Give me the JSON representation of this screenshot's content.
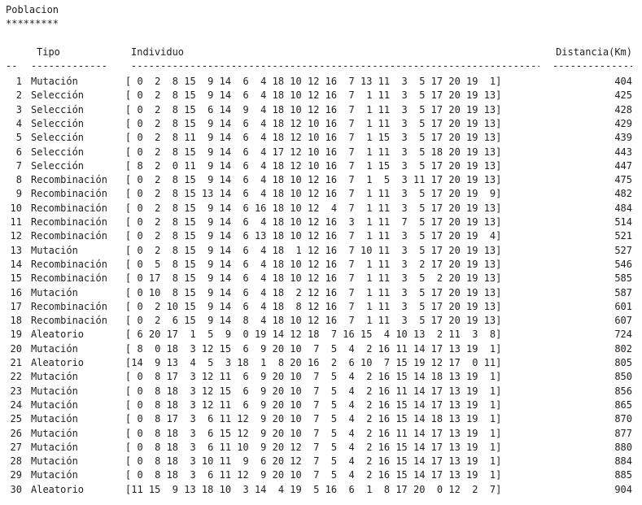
{
  "title": "Poblacion",
  "title_underline": "*********",
  "headers": {
    "tipo": "Tipo",
    "individuo": "Individuo",
    "distancia": "Distancia(Km)"
  },
  "separator": {
    "idx": "--",
    "tipo": "-------------",
    "individuo": "------------------------------------------------------------------------------------",
    "distancia": "--------------"
  },
  "rows": [
    {
      "idx": "1",
      "tipo": "Mutación",
      "individuo": "[ 0  2  8 15  9 14  6  4 18 10 12 16  7 13 11  3  5 17 20 19  1]",
      "distancia": "404"
    },
    {
      "idx": "2",
      "tipo": "Selección",
      "individuo": "[ 0  2  8 15  9 14  6  4 18 10 12 16  7  1 11  3  5 17 20 19 13]",
      "distancia": "425"
    },
    {
      "idx": "3",
      "tipo": "Selección",
      "individuo": "[ 0  2  8 15  6 14  9  4 18 10 12 16  7  1 11  3  5 17 20 19 13]",
      "distancia": "428"
    },
    {
      "idx": "4",
      "tipo": "Selección",
      "individuo": "[ 0  2  8 15  9 14  6  4 18 12 10 16  7  1 11  3  5 17 20 19 13]",
      "distancia": "429"
    },
    {
      "idx": "5",
      "tipo": "Selección",
      "individuo": "[ 0  2  8 11  9 14  6  4 18 12 10 16  7  1 15  3  5 17 20 19 13]",
      "distancia": "439"
    },
    {
      "idx": "6",
      "tipo": "Selección",
      "individuo": "[ 0  2  8 15  9 14  6  4 17 12 10 16  7  1 11  3  5 18 20 19 13]",
      "distancia": "443"
    },
    {
      "idx": "7",
      "tipo": "Selección",
      "individuo": "[ 8  2  0 11  9 14  6  4 18 12 10 16  7  1 15  3  5 17 20 19 13]",
      "distancia": "447"
    },
    {
      "idx": "8",
      "tipo": "Recombinación",
      "individuo": "[ 0  2  8 15  9 14  6  4 18 10 12 16  7  1  5  3 11 17 20 19 13]",
      "distancia": "475"
    },
    {
      "idx": "9",
      "tipo": "Recombinación",
      "individuo": "[ 0  2  8 15 13 14  6  4 18 10 12 16  7  1 11  3  5 17 20 19  9]",
      "distancia": "482"
    },
    {
      "idx": "10",
      "tipo": "Recombinación",
      "individuo": "[ 0  2  8 15  9 14  6 16 18 10 12  4  7  1 11  3  5 17 20 19 13]",
      "distancia": "484"
    },
    {
      "idx": "11",
      "tipo": "Recombinación",
      "individuo": "[ 0  2  8 15  9 14  6  4 18 10 12 16  3  1 11  7  5 17 20 19 13]",
      "distancia": "514"
    },
    {
      "idx": "12",
      "tipo": "Recombinación",
      "individuo": "[ 0  2  8 15  9 14  6 13 18 10 12 16  7  1 11  3  5 17 20 19  4]",
      "distancia": "521"
    },
    {
      "idx": "13",
      "tipo": "Mutación",
      "individuo": "[ 0  2  8 15  9 14  6  4 18  1 12 16  7 10 11  3  5 17 20 19 13]",
      "distancia": "527"
    },
    {
      "idx": "14",
      "tipo": "Recombinación",
      "individuo": "[ 0  5  8 15  9 14  6  4 18 10 12 16  7  1 11  3  2 17 20 19 13]",
      "distancia": "546"
    },
    {
      "idx": "15",
      "tipo": "Recombinación",
      "individuo": "[ 0 17  8 15  9 14  6  4 18 10 12 16  7  1 11  3  5  2 20 19 13]",
      "distancia": "585"
    },
    {
      "idx": "16",
      "tipo": "Mutación",
      "individuo": "[ 0 10  8 15  9 14  6  4 18  2 12 16  7  1 11  3  5 17 20 19 13]",
      "distancia": "587"
    },
    {
      "idx": "17",
      "tipo": "Recombinación",
      "individuo": "[ 0  2 10 15  9 14  6  4 18  8 12 16  7  1 11  3  5 17 20 19 13]",
      "distancia": "601"
    },
    {
      "idx": "18",
      "tipo": "Recombinación",
      "individuo": "[ 0  2  6 15  9 14  8  4 18 10 12 16  7  1 11  3  5 17 20 19 13]",
      "distancia": "607"
    },
    {
      "idx": "19",
      "tipo": "Aleatorio",
      "individuo": "[ 6 20 17  1  5  9  0 19 14 12 18  7 16 15  4 10 13  2 11  3  8]",
      "distancia": "724"
    },
    {
      "idx": "20",
      "tipo": "Mutación",
      "individuo": "[ 8  0 18  3 12 15  6  9 20 10  7  5  4  2 16 11 14 17 13 19  1]",
      "distancia": "802"
    },
    {
      "idx": "21",
      "tipo": "Aleatorio",
      "individuo": "[14  9 13  4  5  3 18  1  8 20 16  2  6 10  7 15 19 12 17  0 11]",
      "distancia": "805"
    },
    {
      "idx": "22",
      "tipo": "Mutación",
      "individuo": "[ 0  8 17  3 12 11  6  9 20 10  7  5  4  2 16 15 14 18 13 19  1]",
      "distancia": "850"
    },
    {
      "idx": "23",
      "tipo": "Mutación",
      "individuo": "[ 0  8 18  3 12 15  6  9 20 10  7  5  4  2 16 11 14 17 13 19  1]",
      "distancia": "856"
    },
    {
      "idx": "24",
      "tipo": "Mutación",
      "individuo": "[ 0  8 18  3 12 11  6  9 20 10  7  5  4  2 16 15 14 17 13 19  1]",
      "distancia": "865"
    },
    {
      "idx": "25",
      "tipo": "Mutación",
      "individuo": "[ 0  8 17  3  6 11 12  9 20 10  7  5  4  2 16 15 14 18 13 19  1]",
      "distancia": "870"
    },
    {
      "idx": "26",
      "tipo": "Mutación",
      "individuo": "[ 0  8 18  3  6 15 12  9 20 10  7  5  4  2 16 11 14 17 13 19  1]",
      "distancia": "877"
    },
    {
      "idx": "27",
      "tipo": "Mutación",
      "individuo": "[ 0  8 18  3  6 11 10  9 20 12  7  5  4  2 16 15 14 17 13 19  1]",
      "distancia": "880"
    },
    {
      "idx": "28",
      "tipo": "Mutación",
      "individuo": "[ 0  8 18  3 10 11  9  6 20 12  7  5  4  2 16 15 14 17 13 19  1]",
      "distancia": "884"
    },
    {
      "idx": "29",
      "tipo": "Mutación",
      "individuo": "[ 0  8 18  3  6 11 12  9 20 10  7  5  4  2 16 15 14 17 13 19  1]",
      "distancia": "885"
    },
    {
      "idx": "30",
      "tipo": "Aleatorio",
      "individuo": "[11 15  9 13 18 10  3 14  4 19  5 16  6  1  8 17 20  0 12  2  7]",
      "distancia": "904"
    }
  ]
}
